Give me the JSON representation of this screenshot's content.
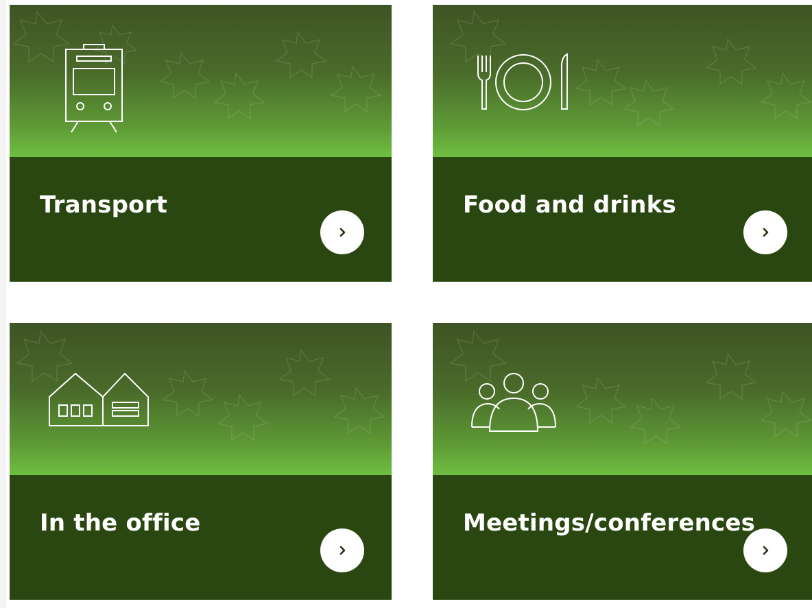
{
  "cards": [
    {
      "title": "Transport",
      "icon": "train-icon",
      "action": "chevron-right-icon"
    },
    {
      "title": "Food and drinks",
      "icon": "fork-plate-knife-icon",
      "action": "chevron-right-icon"
    },
    {
      "title": "In the office",
      "icon": "office-building-icon",
      "action": "chevron-right-icon"
    },
    {
      "title": "Meetings/conferences",
      "icon": "people-group-icon",
      "action": "chevron-right-icon"
    }
  ],
  "colors": {
    "card_bottom": "#2b4711",
    "card_top_dark": "#3f5424",
    "card_top_light": "#6fbf40",
    "button": "#ffffff",
    "text": "#ffffff"
  }
}
